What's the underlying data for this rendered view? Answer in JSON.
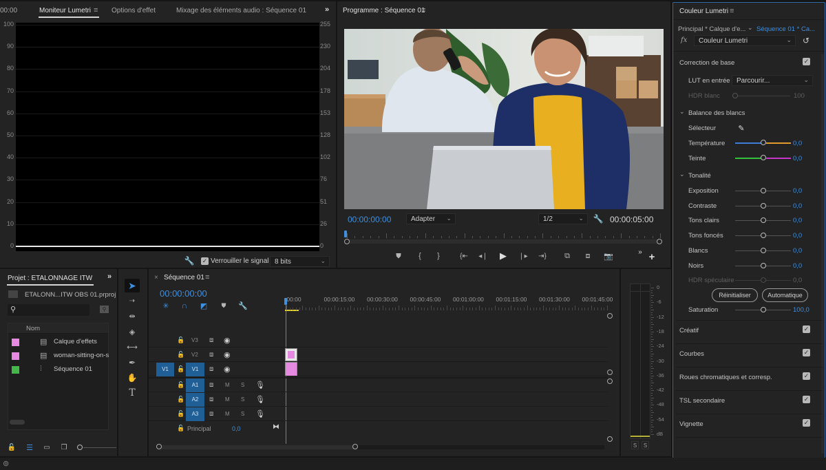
{
  "lumetri_monitor": {
    "timecode_partial": "00:00",
    "tabs": [
      {
        "label": "Moniteur Lumetri",
        "active": true
      },
      {
        "label": "Options d'effet",
        "active": false
      },
      {
        "label": "Mixage des éléments audio : Séquence 01",
        "active": false
      }
    ],
    "overflow_icon": "double-chevron-right",
    "scale_left": [
      "100",
      "90",
      "80",
      "70",
      "60",
      "50",
      "40",
      "30",
      "20",
      "10",
      "0"
    ],
    "scale_right": [
      "255",
      "230",
      "204",
      "178",
      "153",
      "128",
      "102",
      "76",
      "51",
      "26",
      "0"
    ],
    "clamp_signal_label": "Verrouiller le signal",
    "clamp_signal_checked": true,
    "bit_depth": "8 bits"
  },
  "program_monitor": {
    "title": "Programme : Séquence 01",
    "current_timecode": "00:00:00:00",
    "zoom_select": "Adapter",
    "resolution_select": "1/2",
    "duration": "00:00:05:00",
    "transport_icons": [
      "marker",
      "mark-in",
      "mark-out",
      "go-to-in",
      "step-back",
      "play",
      "step-forward",
      "go-to-out",
      "insert",
      "overwrite",
      "export-frame"
    ]
  },
  "lumetri_color": {
    "title": "Couleur Lumetri",
    "source_master": "Principal * Calque d'e...",
    "source_sequence": "Séquence 01 * Ca...",
    "effect_select": "Couleur Lumetri",
    "basic": {
      "title": "Correction de base",
      "enabled": true,
      "lut_label": "LUT en entrée",
      "lut_value": "Parcourir...",
      "hdr_white_label": "HDR blanc",
      "hdr_white_value": "100",
      "white_balance_title": "Balance des blancs",
      "picker_label": "Sélecteur",
      "temperature_label": "Température",
      "temperature_value": "0,0",
      "tint_label": "Teinte",
      "tint_value": "0,0",
      "tone_title": "Tonalité",
      "tone_sliders": [
        {
          "label": "Exposition",
          "value": "0,0",
          "enabled": true
        },
        {
          "label": "Contraste",
          "value": "0,0",
          "enabled": true
        },
        {
          "label": "Tons clairs",
          "value": "0,0",
          "enabled": true
        },
        {
          "label": "Tons foncés",
          "value": "0,0",
          "enabled": true
        },
        {
          "label": "Blancs",
          "value": "0,0",
          "enabled": true
        },
        {
          "label": "Noirs",
          "value": "0,0",
          "enabled": true
        },
        {
          "label": "HDR spéculaire",
          "value": "0,0",
          "enabled": false
        }
      ],
      "reset_label": "Réinitialiser",
      "auto_label": "Automatique",
      "saturation_label": "Saturation",
      "saturation_value": "100,0"
    },
    "sections": [
      {
        "label": "Créatif",
        "enabled": true
      },
      {
        "label": "Courbes",
        "enabled": true
      },
      {
        "label": "Roues chromatiques et corresp.",
        "enabled": true
      },
      {
        "label": "TSL secondaire",
        "enabled": true
      },
      {
        "label": "Vignette",
        "enabled": true
      }
    ]
  },
  "project": {
    "tab_label": "Projet : ETALONNAGE ITW OBS",
    "file_name": "ETALONN...ITW OBS 01.prproj",
    "search_placeholder": "",
    "column_name": "Nom",
    "items": [
      {
        "label": "Calque d'effets",
        "color": "#e58ae0",
        "icon": "adjustment-layer"
      },
      {
        "label": "woman-sitting-on-s",
        "color": "#e58ae0",
        "icon": "clip"
      },
      {
        "label": "Séquence 01",
        "color": "#44b64a",
        "icon": "sequence"
      }
    ]
  },
  "tools": [
    "selection",
    "track-select-forward",
    "ripple-edit",
    "razor",
    "slip",
    "pen",
    "hand",
    "type"
  ],
  "timeline": {
    "tab_label": "Séquence 01",
    "timecode": "00:00:00:00",
    "ruler": [
      ":00:00",
      "00:00:15:00",
      "00:00:30:00",
      "00:00:45:00",
      "00:01:00:00",
      "00:01:15:00",
      "00:01:30:00",
      "00:01:45:00"
    ],
    "video_tracks": [
      {
        "name": "V3",
        "source": "",
        "targeted": false
      },
      {
        "name": "V2",
        "source": "",
        "targeted": false
      },
      {
        "name": "V1",
        "source": "V1",
        "targeted": true
      }
    ],
    "audio_tracks": [
      {
        "name": "A1",
        "mute": "M",
        "solo": "S"
      },
      {
        "name": "A2",
        "mute": "M",
        "solo": "S"
      },
      {
        "name": "A3",
        "mute": "M",
        "solo": "S"
      }
    ],
    "master_label": "Principal",
    "master_value": "0,0",
    "clip_color": "#e58ae0"
  },
  "audio_meter": {
    "scale": [
      "0",
      "-6",
      "-12",
      "-18",
      "-24",
      "-30",
      "-36",
      "-42",
      "-48",
      "-54",
      "dB"
    ],
    "solo_left": "S",
    "solo_right": "S"
  }
}
